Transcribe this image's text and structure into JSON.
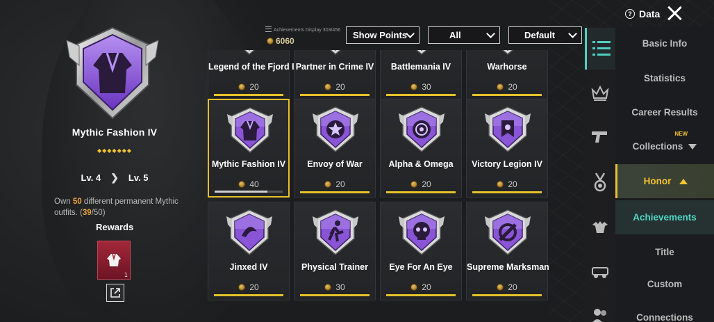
{
  "header": {
    "data_label": "Data",
    "achievements_display": "Achievements Display  303/456",
    "points_total": "6060"
  },
  "filters": {
    "points_filter": "Show Points",
    "category_filter": "All",
    "sort_filter": "Default"
  },
  "detail": {
    "title": "Mythic Fashion IV",
    "stars": "◆◆◆◆◆◆◆",
    "level_from": "Lv. 4",
    "level_to": "Lv. 5",
    "desc_prefix": "Own ",
    "desc_target": "50",
    "desc_middle": " different permanent Mythic outfits. (",
    "desc_current": "39",
    "desc_suffix": "/50)",
    "rewards_label": "Rewards",
    "reward_count": "1"
  },
  "achievements": [
    {
      "name": "Legend of the Fjord IV",
      "points": "20",
      "icon": "shield-badge"
    },
    {
      "name": "Partner in Crime IV",
      "points": "20",
      "icon": "shield-badge"
    },
    {
      "name": "Battlemania IV",
      "points": "30",
      "icon": "shield-badge"
    },
    {
      "name": "Warhorse",
      "points": "20",
      "icon": "shield-badge"
    },
    {
      "name": "Mythic Fashion IV",
      "points": "40",
      "icon": "jacket-badge",
      "selected": true,
      "progress": 0.78
    },
    {
      "name": "Envoy of War",
      "points": "20",
      "icon": "star-badge"
    },
    {
      "name": "Alpha & Omega",
      "points": "20",
      "icon": "target-badge"
    },
    {
      "name": "Victory Legion IV",
      "points": "20",
      "icon": "banner-badge"
    },
    {
      "name": "Jinxed IV",
      "points": "20",
      "icon": "swirl-badge"
    },
    {
      "name": "Physical Trainer",
      "points": "30",
      "icon": "runner-badge"
    },
    {
      "name": "Eye For An Eye",
      "points": "20",
      "icon": "skull-badge"
    },
    {
      "name": "Supreme Marksman",
      "points": "20",
      "icon": "crosshair-badge"
    }
  ],
  "nav": {
    "basic_info": "Basic Info",
    "statistics": "Statistics",
    "career_results": "Career Results",
    "collections": "Collections",
    "new_tag": "NEW",
    "honor": "Honor",
    "achievements": "Achievements",
    "title": "Title",
    "custom": "Custom",
    "connections": "Connections"
  },
  "colors": {
    "accent_gold": "#e7c02a",
    "accent_teal": "#4fd0c2",
    "badge_purple": "#8a54d6"
  }
}
